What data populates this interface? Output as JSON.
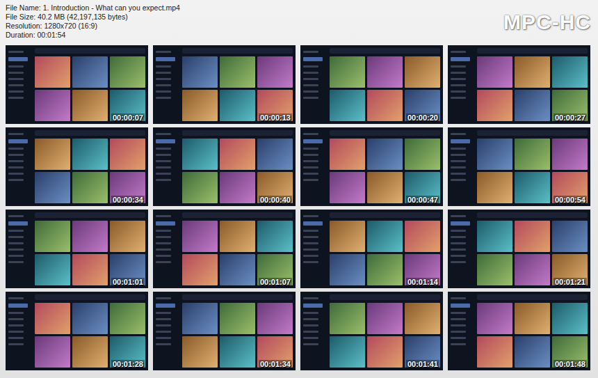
{
  "header": {
    "lines": [
      "File Name: 1. Introduction - What can you expect.mp4",
      "File Size: 40.2 MB (42,197,135 bytes)",
      "Resolution: 1280x720 (16:9)",
      "Duration: 00:01:54"
    ]
  },
  "logo": "MPC-HC",
  "thumbnails": [
    {
      "time": "00:00:07"
    },
    {
      "time": "00:00:13"
    },
    {
      "time": "00:00:20"
    },
    {
      "time": "00:00:27"
    },
    {
      "time": "00:00:34"
    },
    {
      "time": "00:00:40"
    },
    {
      "time": "00:00:47"
    },
    {
      "time": "00:00:54"
    },
    {
      "time": "00:01:01"
    },
    {
      "time": "00:01:07"
    },
    {
      "time": "00:01:14"
    },
    {
      "time": "00:01:21"
    },
    {
      "time": "00:01:28"
    },
    {
      "time": "00:01:34"
    },
    {
      "time": "00:01:41"
    },
    {
      "time": "00:01:48"
    }
  ]
}
